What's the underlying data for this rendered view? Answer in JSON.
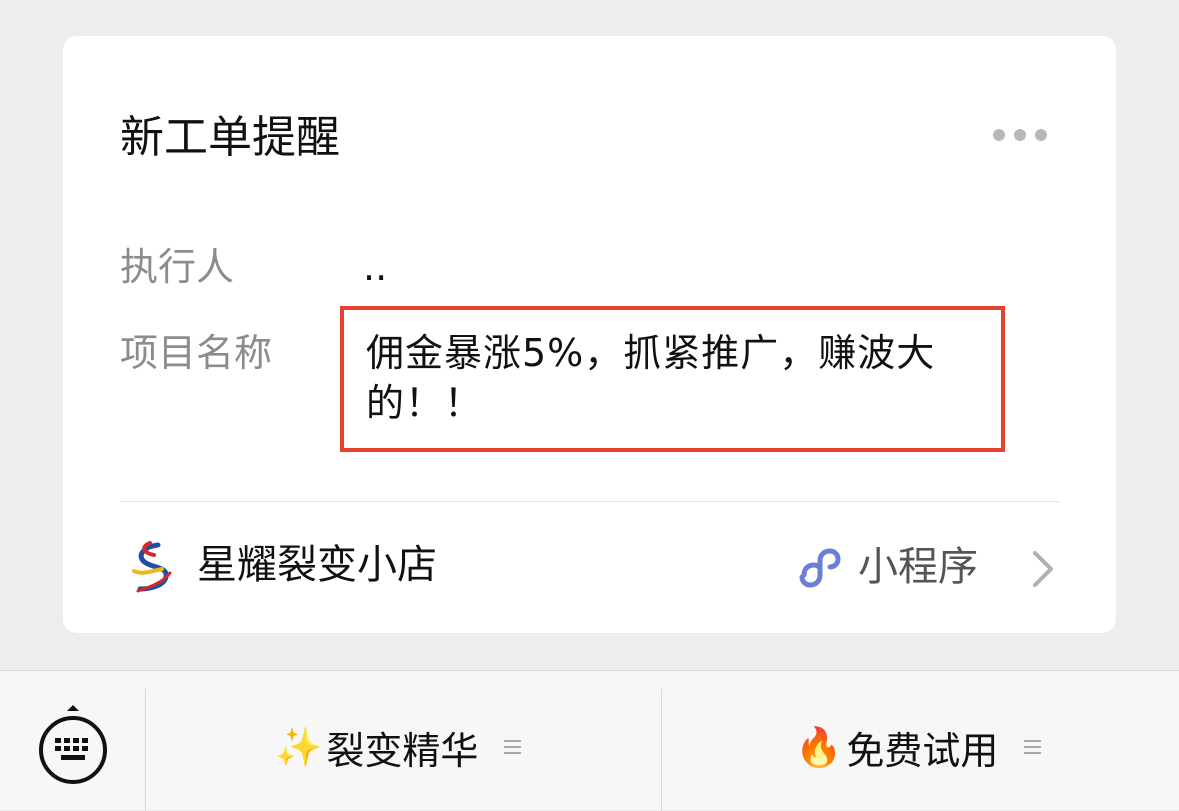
{
  "card": {
    "title": "新工单提醒",
    "fields": [
      {
        "label": "执行人",
        "value": ".."
      },
      {
        "label": "项目名称",
        "value": "佣金暴涨5%，抓紧推广，赚波大的！！"
      }
    ],
    "shop_name": "星耀裂变小店",
    "mini_program_label": "小程序"
  },
  "bottom_bar": {
    "menus": [
      {
        "emoji": "✨",
        "label": "裂变精华"
      },
      {
        "emoji": "🔥",
        "label": "免费试用"
      }
    ]
  },
  "colors": {
    "highlight_border": "#e4412f",
    "mini_program_icon": "#6b7fd7",
    "background": "#ededed"
  }
}
